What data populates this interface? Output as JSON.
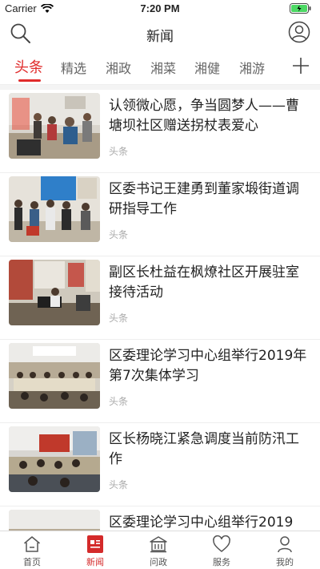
{
  "status_bar": {
    "carrier": "Carrier",
    "time": "7:20 PM"
  },
  "header": {
    "title": "新闻"
  },
  "tabs": [
    {
      "label": "头条",
      "active": true
    },
    {
      "label": "精选"
    },
    {
      "label": "湘政"
    },
    {
      "label": "湘菜"
    },
    {
      "label": "湘健"
    },
    {
      "label": "湘游"
    }
  ],
  "news": [
    {
      "title": "认领微心愿，争当圆梦人——曹塘坝社区赠送拐杖表爱心",
      "source": "头条"
    },
    {
      "title": "区委书记王建勇到董家塅街道调研指导工作",
      "source": "头条"
    },
    {
      "title": "副区长杜益在枫燎社区开展驻室接待活动",
      "source": "头条"
    },
    {
      "title": "区委理论学习中心组举行2019年第7次集体学习",
      "source": "头条"
    },
    {
      "title": "区长杨晓江紧急调度当前防汛工作",
      "source": "头条"
    },
    {
      "title": "区委理论学习中心组举行2019",
      "source": ""
    }
  ],
  "bottom_nav": [
    {
      "label": "首页",
      "icon": "home-icon"
    },
    {
      "label": "新闻",
      "icon": "news-icon",
      "active": true
    },
    {
      "label": "问政",
      "icon": "building-icon"
    },
    {
      "label": "服务",
      "icon": "heart-icon"
    },
    {
      "label": "我的",
      "icon": "person-icon"
    }
  ],
  "colors": {
    "accent": "#e02b2b",
    "battery": "#4cd964"
  }
}
